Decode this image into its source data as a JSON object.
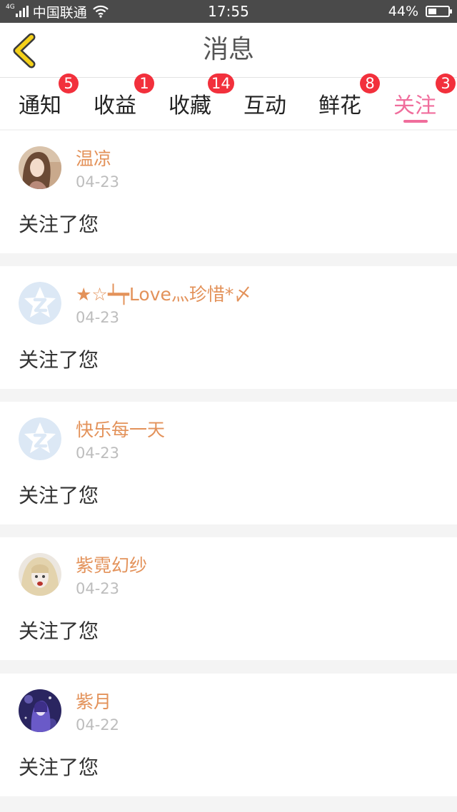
{
  "status_bar": {
    "network": "4G",
    "carrier": "中国联通",
    "time": "17:55",
    "battery": "44%",
    "battery_level": 0.44
  },
  "header": {
    "title": "消息",
    "back_icon": "chevron-left-icon",
    "back_color": "#f5d11a"
  },
  "tabs": [
    {
      "label": "通知",
      "badge": "5"
    },
    {
      "label": "收益",
      "badge": "1"
    },
    {
      "label": "收藏",
      "badge": "14"
    },
    {
      "label": "互动",
      "badge": ""
    },
    {
      "label": "鲜花",
      "badge": "8"
    },
    {
      "label": "关注",
      "badge": "3",
      "active": true
    }
  ],
  "colors": {
    "accent": "#f06d9c",
    "badge": "#f2303c",
    "username": "#e3925a"
  },
  "messages": [
    {
      "name": "温凉",
      "date": "04-23",
      "text": "关注了您",
      "avatar": "photo-avatar"
    },
    {
      "name": "★☆┷┯Love灬珍惜*〆",
      "date": "04-23",
      "text": "关注了您",
      "avatar": "default-star-avatar"
    },
    {
      "name": "快乐每一天",
      "date": "04-23",
      "text": "关注了您",
      "avatar": "default-star-avatar"
    },
    {
      "name": "紫霓幻纱",
      "date": "04-23",
      "text": "关注了您",
      "avatar": "photo-avatar"
    },
    {
      "name": "紫月",
      "date": "04-22",
      "text": "关注了您",
      "avatar": "photo-avatar"
    }
  ]
}
